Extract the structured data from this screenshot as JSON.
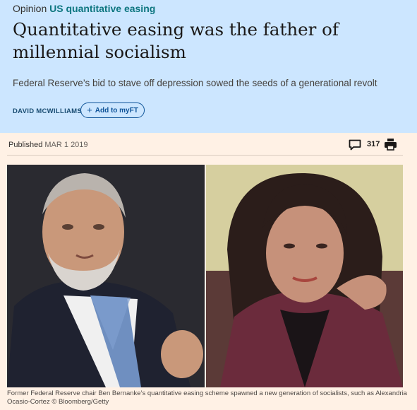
{
  "header": {
    "topic_prefix": "Opinion",
    "topic_tag": "US quantitative easing",
    "headline": "Quantitative easing was the father of millennial socialism",
    "standfirst": "Federal Reserve’s bid to stave off depression sowed the seeds of a generational revolt",
    "author": "DAVID MCWILLIAMS",
    "myft_label": "Add to myFT"
  },
  "meta": {
    "published_label": "Published",
    "published_date": "MAR 1 2019",
    "comment_count": "317"
  },
  "icons": {
    "comment": "speech-bubble-icon",
    "print": "printer-icon",
    "add": "plus-icon"
  },
  "image": {
    "caption": "Former Federal Reserve chair Ben Bernanke’s quantitative easing scheme spawned a new generation of socialists, such as Alexandria Ocasio-Cortez © Bloomberg/Getty"
  },
  "colors": {
    "header_bg": "#cce6ff",
    "page_bg": "#fff1e5",
    "topic_link": "#0d7680",
    "author": "#1a4d73",
    "button": "#0f5499"
  }
}
